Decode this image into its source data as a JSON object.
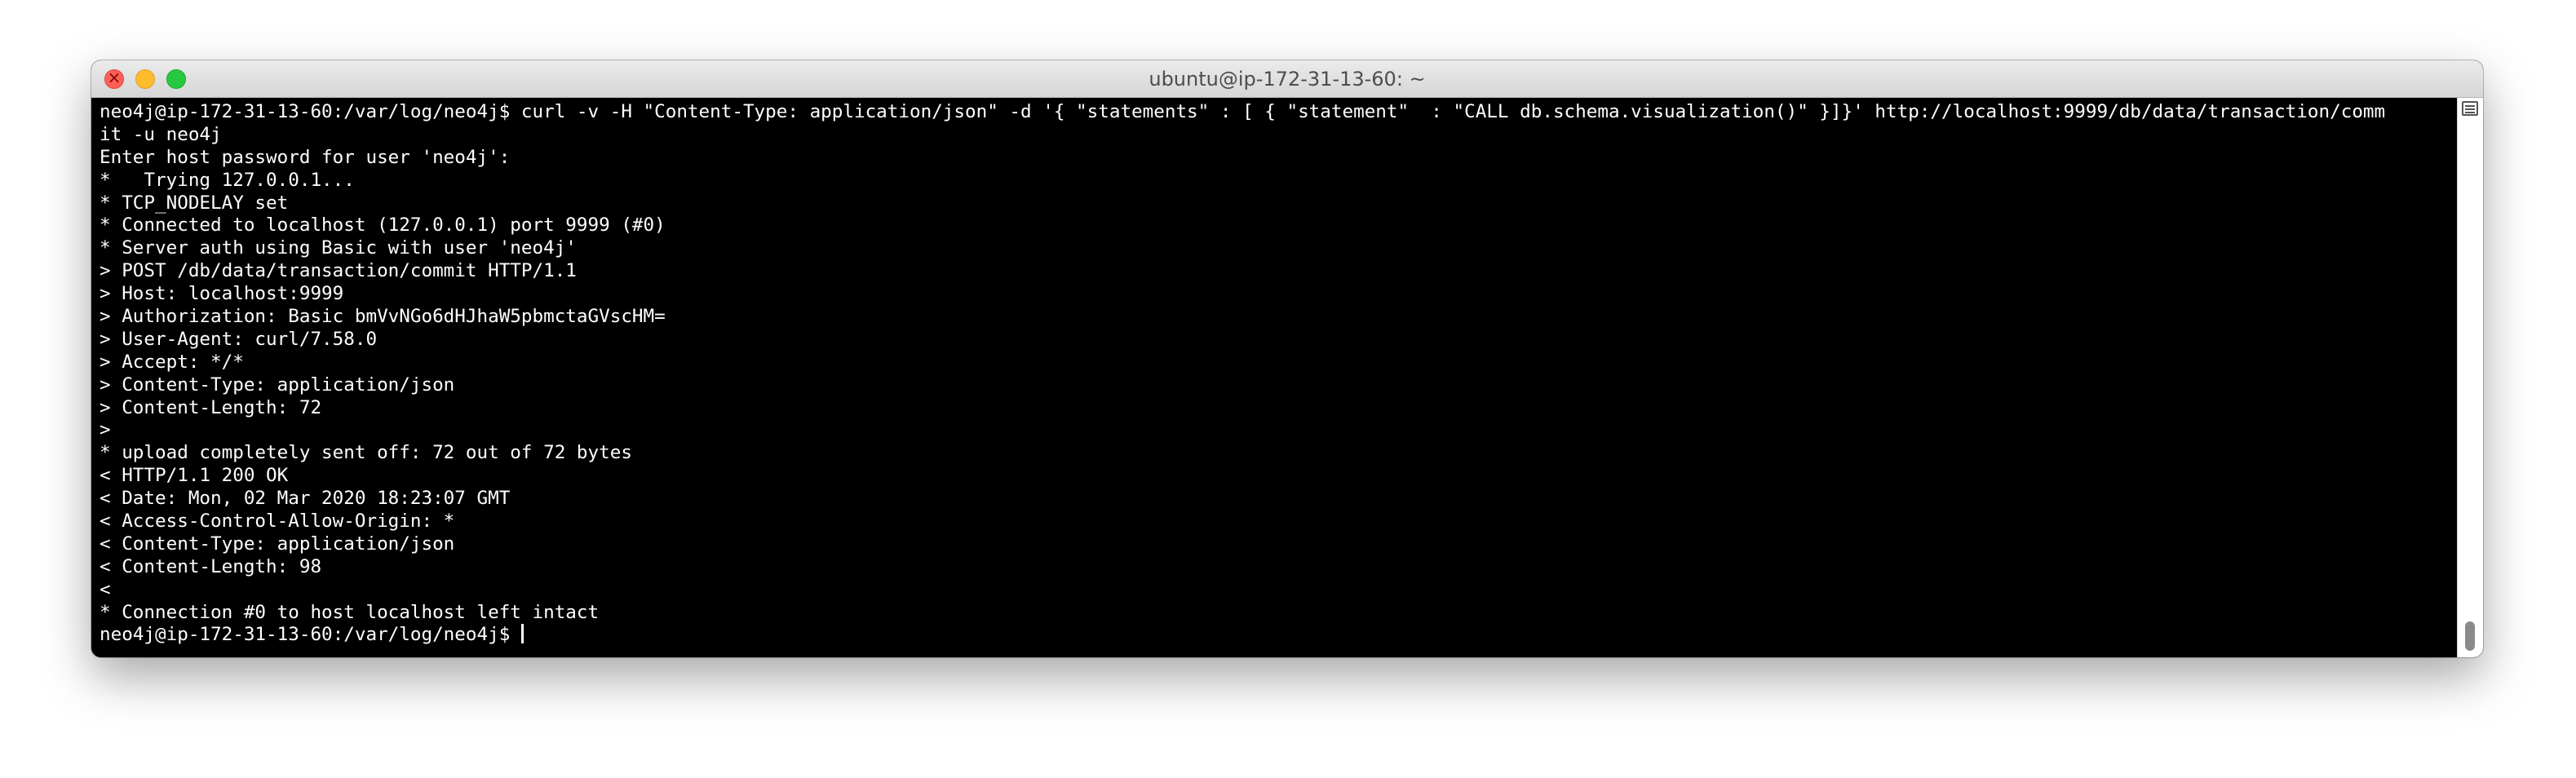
{
  "window": {
    "title": "ubuntu@ip-172-31-13-60: ~"
  },
  "icons": {
    "close": "close-icon",
    "minimize": "minimize-icon",
    "zoom": "zoom-icon",
    "scroll_menu": "list-menu-icon"
  },
  "colors": {
    "terminal_background": "#000000",
    "terminal_text": "#ffffff",
    "close": "#fe5f57",
    "minimize": "#febc2e",
    "zoom": "#28c840"
  },
  "terminal": {
    "lines": [
      "neo4j@ip-172-31-13-60:/var/log/neo4j$ curl -v -H \"Content-Type: application/json\" -d '{ \"statements\" : [ { \"statement\"  : \"CALL db.schema.visualization()\" }]}' http://localhost:9999/db/data/transaction/comm",
      "it -u neo4j",
      "Enter host password for user 'neo4j':",
      "*   Trying 127.0.0.1...",
      "* TCP_NODELAY set",
      "* Connected to localhost (127.0.0.1) port 9999 (#0)",
      "* Server auth using Basic with user 'neo4j'",
      "> POST /db/data/transaction/commit HTTP/1.1",
      "> Host: localhost:9999",
      "> Authorization: Basic bmVvNGo6dHJhaW5pbmctaGVscHM=",
      "> User-Agent: curl/7.58.0",
      "> Accept: */*",
      "> Content-Type: application/json",
      "> Content-Length: 72",
      ">",
      "* upload completely sent off: 72 out of 72 bytes",
      "< HTTP/1.1 200 OK",
      "< Date: Mon, 02 Mar 2020 18:23:07 GMT",
      "< Access-Control-Allow-Origin: *",
      "< Content-Type: application/json",
      "< Content-Length: 98",
      "<",
      "* Connection #0 to host localhost left intact"
    ],
    "prompt": "neo4j@ip-172-31-13-60:/var/log/neo4j$ "
  }
}
